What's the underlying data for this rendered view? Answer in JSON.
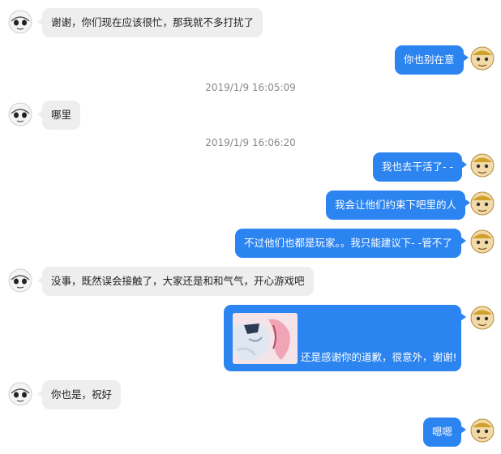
{
  "conversation": {
    "messages": [
      {
        "side": "left",
        "text": "谢谢，你们现在应该很忙，那我就不多打扰了"
      },
      {
        "side": "right",
        "text": "你也别在意"
      },
      {
        "timestamp": "2019/1/9 16:05:09"
      },
      {
        "side": "left",
        "text": "哪里"
      },
      {
        "timestamp": "2019/1/9 16:06:20"
      },
      {
        "side": "right",
        "text": "我也去干活了- -"
      },
      {
        "side": "right",
        "text": "我会让他们约束下吧里的人"
      },
      {
        "side": "right",
        "text": "不过他们也都是玩家。。我只能建议下- -管不了"
      },
      {
        "side": "left",
        "text": "没事，既然误会接触了，大家还是和和气气，开心游戏吧"
      },
      {
        "side": "right",
        "type": "image-text",
        "text": "还是感谢你的道歉，很意外，谢谢!"
      },
      {
        "side": "left",
        "text": "你也是，祝好"
      },
      {
        "side": "right",
        "text": "嗯嗯"
      }
    ]
  },
  "icons": {
    "left_avatar": "cartoon-face-avatar-icon",
    "right_avatar": "monkey-king-avatar-icon"
  },
  "colors": {
    "outgoing_bubble": "#2b84f0",
    "incoming_bubble": "#eeeeee",
    "timestamp_text": "#888888"
  }
}
